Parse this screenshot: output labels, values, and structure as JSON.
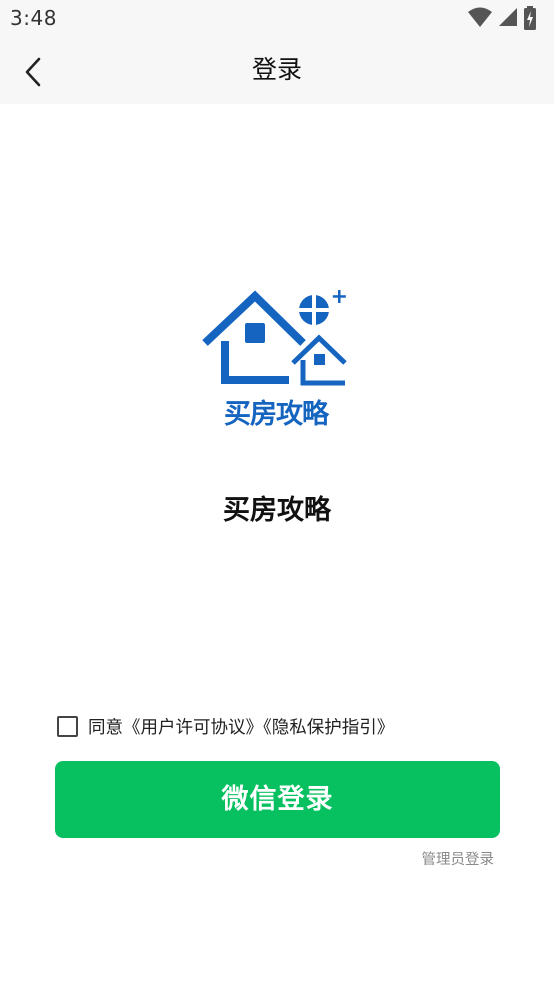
{
  "status_bar": {
    "time": "3:48",
    "icons": [
      "wifi-icon",
      "cellular-signal-icon",
      "battery-charging-icon"
    ]
  },
  "nav": {
    "title": "登录",
    "back_icon": "chevron-left-icon"
  },
  "logo": {
    "text": "买房攻略",
    "color": "#1565c0"
  },
  "app_name": "买房攻略",
  "agreement": {
    "checked": false,
    "text": "同意《用户许可协议》《隐私保护指引》"
  },
  "buttons": {
    "wechat_login": "微信登录",
    "admin_login": "管理员登录"
  },
  "colors": {
    "primary": "#07c160",
    "logo_blue": "#1565c0",
    "header_bg": "#f7f7f7"
  }
}
